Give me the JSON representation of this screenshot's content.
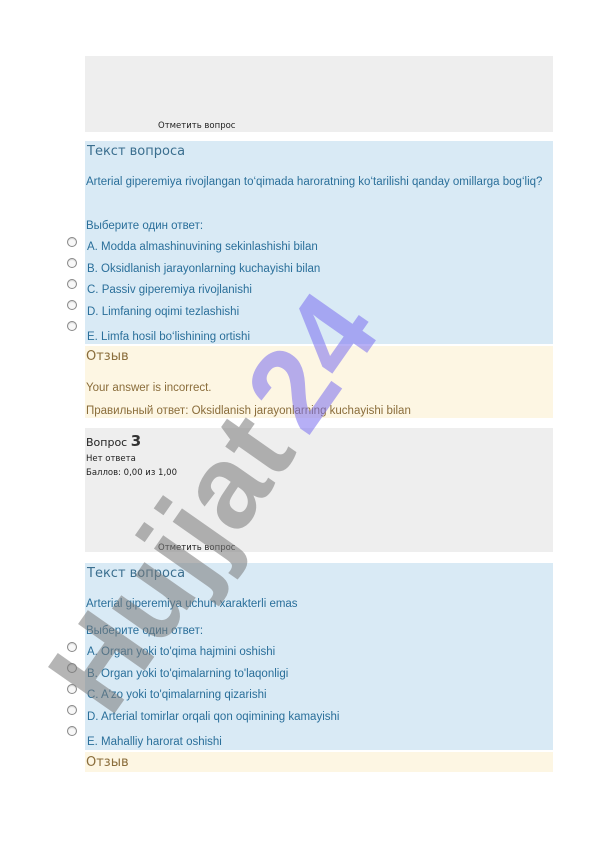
{
  "q2": {
    "flag": "Отметить вопрос",
    "text_heading": "Текст вопроса",
    "question": "Arterial giperemiya rivojlangan to‘qimada haroratning ko‘tarilishi qanday omillarga bog‘liq?",
    "choose": "Выберите один ответ:",
    "options": [
      "A. Modda almashinuvining sekinlashishi bilan",
      "B. Oksidlanish jarayonlarning kuchayishi bilan",
      "C. Passiv giperemiya rivojlanishi",
      "D. Limfaning oqimi tezlashishi",
      "E. Limfa hosil bo‘lishining ortishi"
    ],
    "feedback_heading": "Отзыв",
    "feedback": "Your answer is incorrect.",
    "correct": "Правильный ответ: Oksidlanish jarayonlarning kuchayishi bilan"
  },
  "q3": {
    "label": "Вопрос",
    "number": "3",
    "status": "Нет ответа",
    "score": "Баллов: 0,00 из 1,00",
    "flag": "Отметить вопрос",
    "text_heading": "Текст вопроса",
    "question": "Arterial giperemiya uchun xarakterli emas",
    "choose": "Выберите один ответ:",
    "options": [
      "A. Organ yoki to'qima hajmini oshishi",
      "B. Organ yoki to'qimalarning to'laqonligi",
      "C. A'zo yoki to'qimalarning qizarishi",
      "D. Arterial tomirlar orqali qon oqimining kamayishi",
      "E. Mahalliy harorat oshishi"
    ],
    "feedback_heading": "Отзыв"
  },
  "watermark": {
    "text": "Hujjat 24",
    "colors": [
      "#7a7a7a",
      "#7b6ff0"
    ]
  }
}
